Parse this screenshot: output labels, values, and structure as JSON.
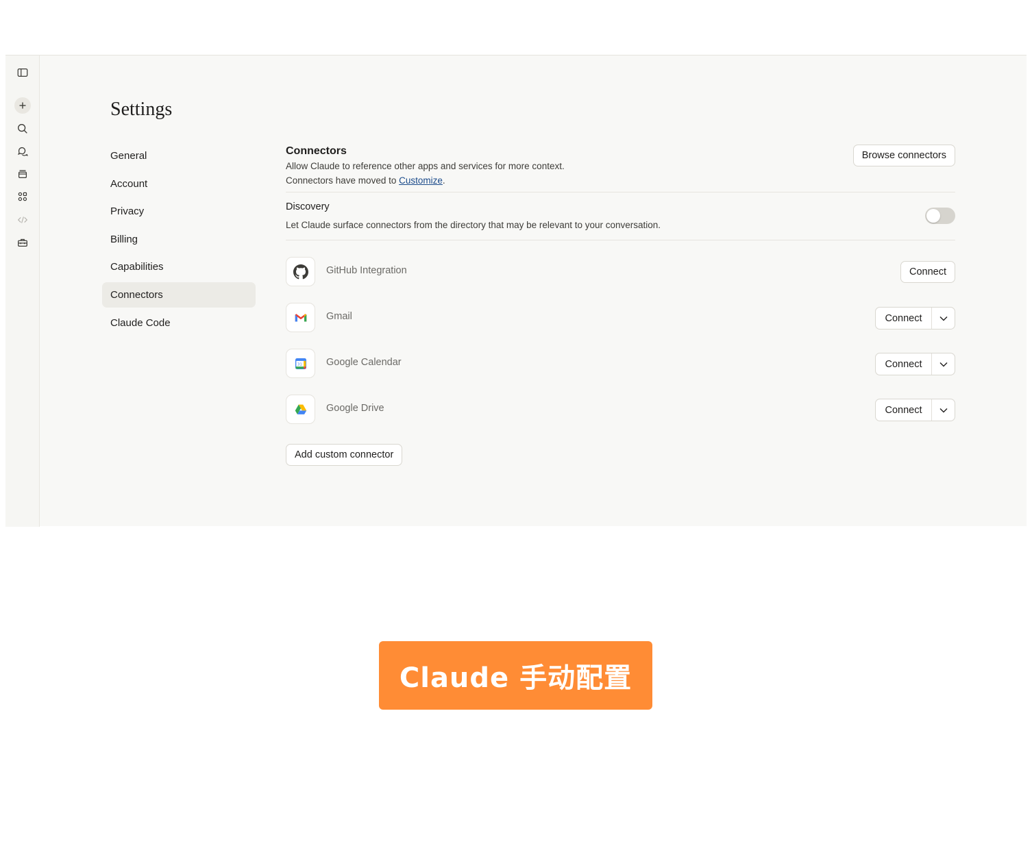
{
  "rail": {
    "icons": [
      "sidebar-toggle-icon",
      "new-chat-icon",
      "search-icon",
      "chats-icon",
      "projects-icon",
      "artifacts-icon",
      "code-icon",
      "toolbox-icon"
    ]
  },
  "settings": {
    "title": "Settings",
    "nav": [
      "General",
      "Account",
      "Privacy",
      "Billing",
      "Capabilities",
      "Connectors",
      "Claude Code"
    ],
    "active_nav": "Connectors"
  },
  "connectors": {
    "heading": "Connectors",
    "description": "Allow Claude to reference other apps and services for more context.",
    "moved_prefix": "Connectors have moved to ",
    "moved_link": "Customize",
    "moved_suffix": ".",
    "browse_label": "Browse connectors",
    "discovery": {
      "heading": "Discovery",
      "description": "Let Claude surface connectors from the directory that may be relevant to your conversation.",
      "enabled": false
    },
    "items": [
      {
        "name": "GitHub Integration",
        "action": "Connect",
        "icon": "github-icon"
      },
      {
        "name": "Gmail",
        "action": "Connect",
        "icon": "gmail-icon"
      },
      {
        "name": "Google Calendar",
        "action": "Connect",
        "icon": "google-calendar-icon"
      },
      {
        "name": "Google Drive",
        "action": "Connect",
        "icon": "google-drive-icon"
      }
    ],
    "add_custom_label": "Add custom connector"
  },
  "banner": {
    "text": "Claude 手动配置",
    "color": "#ff8c35"
  },
  "colors": {
    "app_bg": "#f8f8f6",
    "active_nav_bg": "#ecebe6",
    "link": "#1a4a8a"
  }
}
